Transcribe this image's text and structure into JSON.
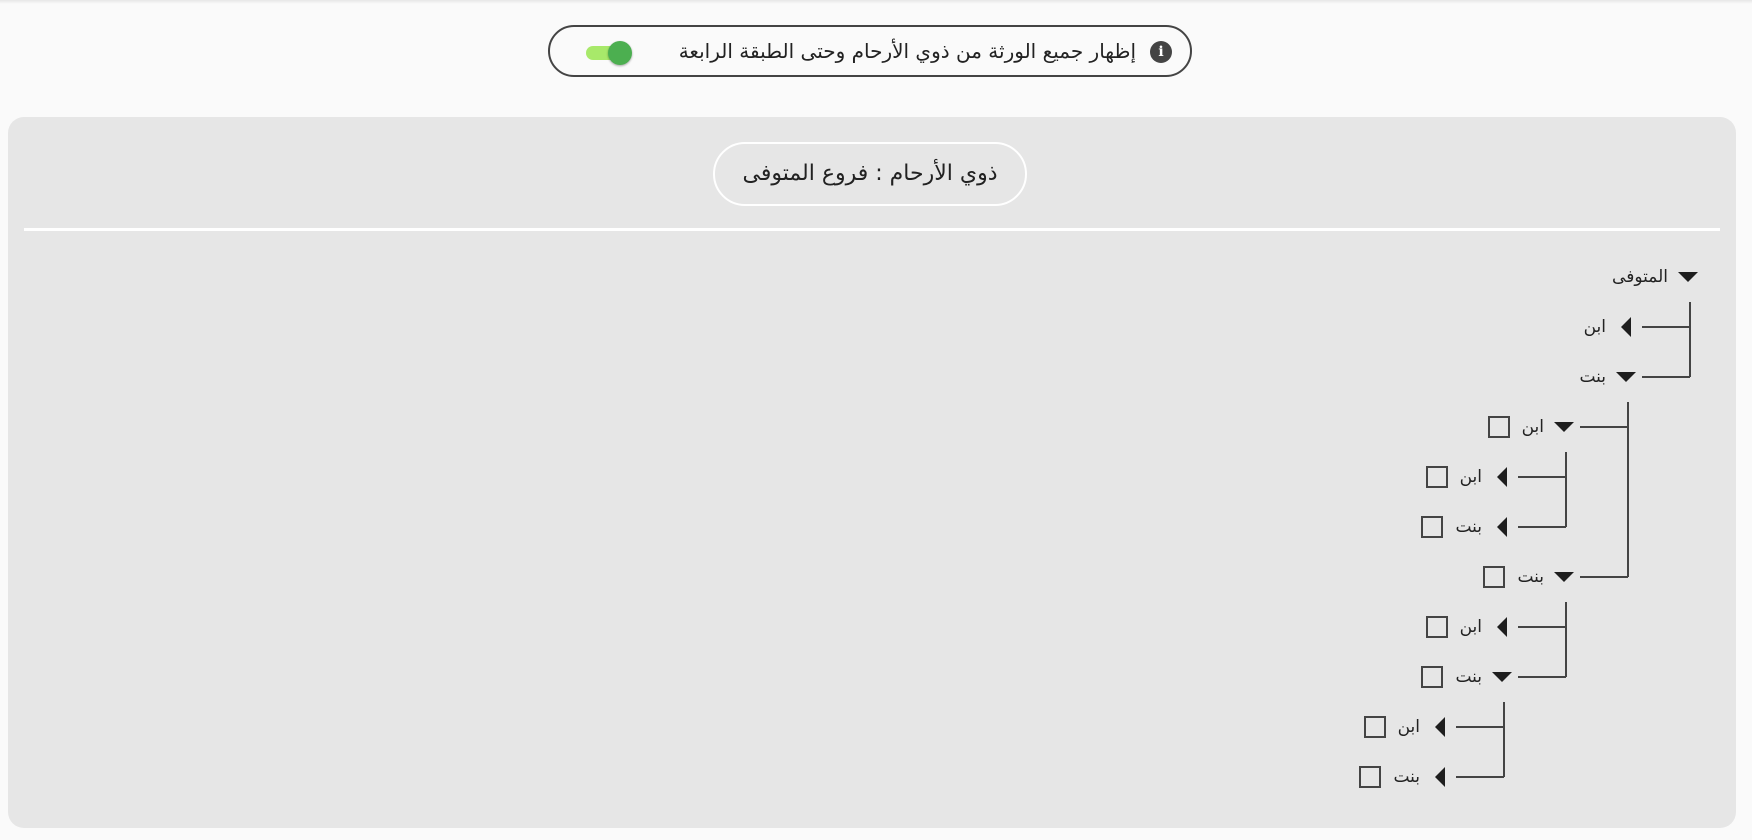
{
  "top_toggle": {
    "label": "إظهار جميع الورثة من ذوي الأرحام وحتى الطبقة الرابعة",
    "info_icon": "info-icon",
    "enabled": true,
    "track_color": "#a8e96a",
    "knob_color": "#4caf50"
  },
  "panel": {
    "title": "ذوي الأرحام : فروع المتوفى"
  },
  "tree": {
    "root": {
      "label": "المتوفى",
      "expanded": true,
      "children": [
        {
          "label": "ابن",
          "expanded": false,
          "checkbox": false
        },
        {
          "label": "بنت",
          "expanded": true,
          "checkbox": false,
          "children": [
            {
              "label": "ابن",
              "expanded": true,
              "checkbox": true,
              "checked": false,
              "children": [
                {
                  "label": "ابن",
                  "expanded": false,
                  "checkbox": true,
                  "checked": false
                },
                {
                  "label": "بنت",
                  "expanded": false,
                  "checkbox": true,
                  "checked": false
                }
              ]
            },
            {
              "label": "بنت",
              "expanded": true,
              "checkbox": true,
              "checked": false,
              "children": [
                {
                  "label": "ابن",
                  "expanded": false,
                  "checkbox": true,
                  "checked": false
                },
                {
                  "label": "بنت",
                  "expanded": true,
                  "checkbox": true,
                  "checked": false,
                  "children": [
                    {
                      "label": "ابن",
                      "expanded": false,
                      "checkbox": true,
                      "checked": false
                    },
                    {
                      "label": "بنت",
                      "expanded": false,
                      "checkbox": true,
                      "checked": false
                    }
                  ]
                }
              ]
            }
          ]
        }
      ]
    }
  }
}
